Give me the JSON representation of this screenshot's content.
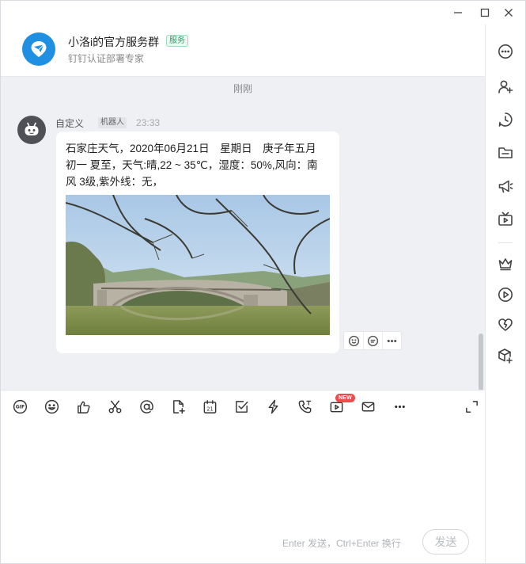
{
  "header": {
    "group_name": "小洛i的官方服务群",
    "badge": "服务",
    "subtitle": "钉钉认证部署专家"
  },
  "messages": {
    "time_divider": "刚刚",
    "sender": "自定义",
    "sender_tag": "机器人",
    "time": "23:33",
    "text": "石家庄天气，2020年06月21日　星期日　庚子年五月\n初一 夏至，天气:晴,22 ~ 35℃，湿度：50%,风向：南\n风 3级,紫外线：无，"
  },
  "toolbar": {
    "new_badge": "NEW"
  },
  "input": {
    "hint": "Enter 发送，Ctrl+Enter 换行",
    "send_label": "发送"
  },
  "icons": {
    "window": [
      "minimize-icon",
      "maximize-icon",
      "close-icon"
    ],
    "right_bar": [
      "more-icon",
      "add-member-icon",
      "history-icon",
      "folder-icon",
      "announcement-icon",
      "live-icon",
      "crown-icon",
      "play-icon",
      "heart-icon",
      "app-plus-icon"
    ],
    "toolbar": [
      "gif-icon",
      "emoji-icon",
      "thumbs-up-icon",
      "scissors-icon",
      "at-icon",
      "file-plus-icon",
      "calendar-icon",
      "todo-icon",
      "ding-icon",
      "phone-icon",
      "video-meeting-icon",
      "mail-icon",
      "more-icon",
      "collapse-icon"
    ]
  },
  "colors": {
    "brand_blue": "#1e8fe1",
    "service_green": "#24a36b",
    "new_red": "#f04b4b",
    "chat_bg": "#eef0f3"
  }
}
